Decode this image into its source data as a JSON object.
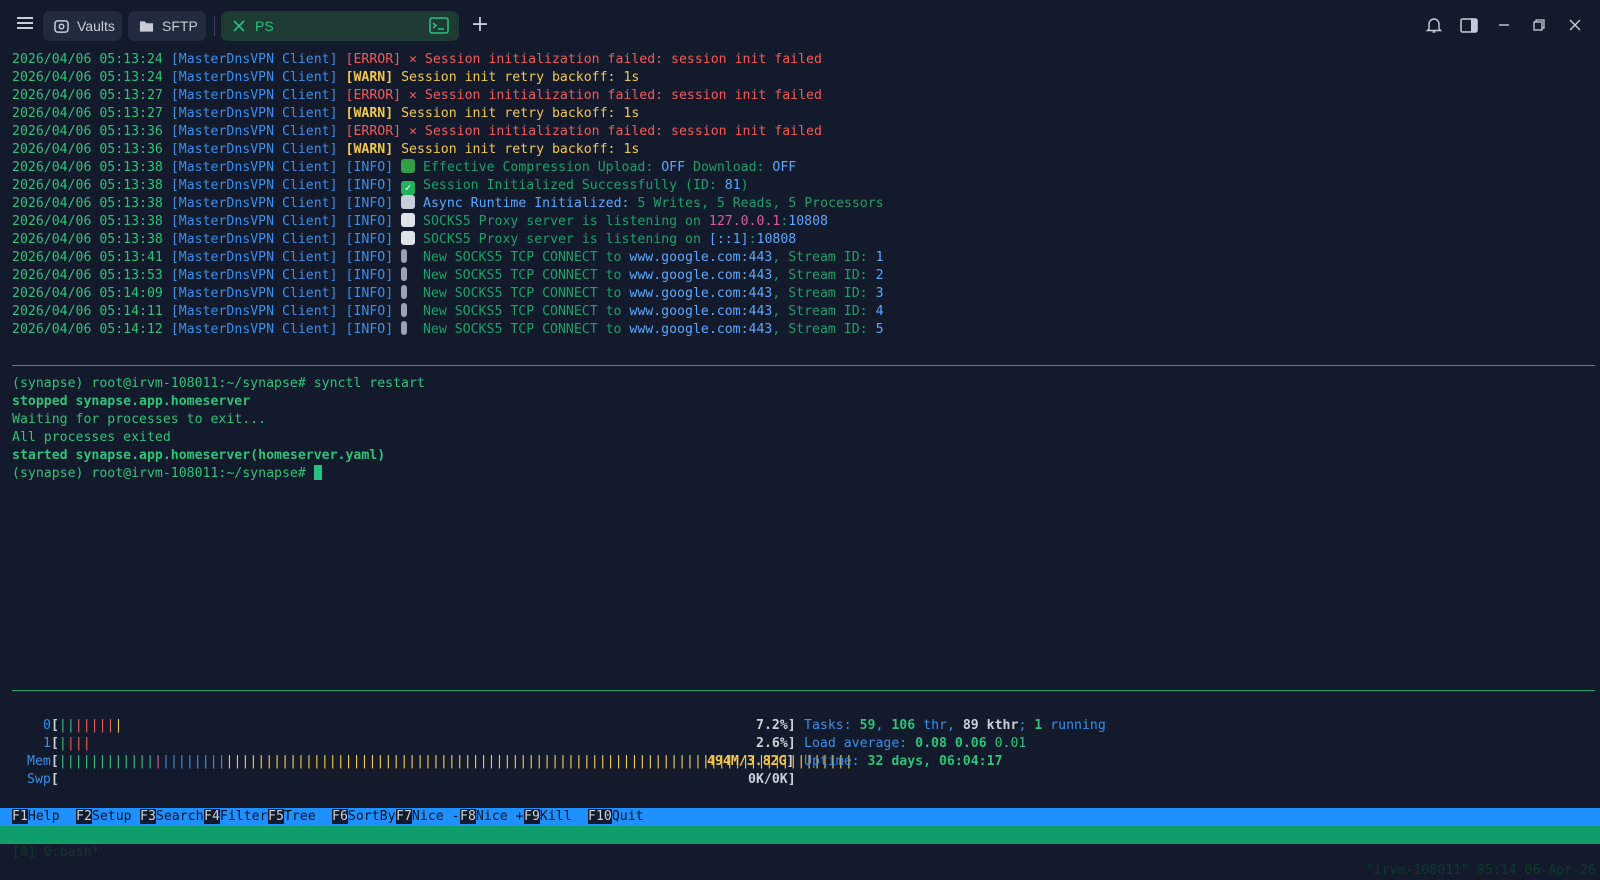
{
  "titlebar": {
    "tabs": [
      {
        "label": "Vaults",
        "icon": "vault-icon"
      },
      {
        "label": "SFTP",
        "icon": "folder-icon"
      },
      {
        "label": "PS",
        "icon": "close-icon",
        "active": true
      }
    ],
    "new_tab": "+"
  },
  "log": {
    "source": "[MasterDnsVPN Client]",
    "lines": [
      {
        "ts": "2026/04/06 05:13:24",
        "level": "[ERROR]",
        "msg": " Session initialization failed: session init failed"
      },
      {
        "ts": "2026/04/06 05:13:24",
        "level": "[WARN]",
        "msg": "Session init retry backoff: 1s"
      },
      {
        "ts": "2026/04/06 05:13:27",
        "level": "[ERROR]",
        "msg": " Session initialization failed: session init failed"
      },
      {
        "ts": "2026/04/06 05:13:27",
        "level": "[WARN]",
        "msg": "Session init retry backoff: 1s"
      },
      {
        "ts": "2026/04/06 05:13:36",
        "level": "[ERROR]",
        "msg": " Session initialization failed: session init failed"
      },
      {
        "ts": "2026/04/06 05:13:36",
        "level": "[WARN]",
        "msg": "Session init retry backoff: 1s"
      },
      {
        "ts": "2026/04/06 05:13:38",
        "level": "[INFO]",
        "p1": "Effective Compression Upload: ",
        "v1": "OFF",
        "p2": " Download: ",
        "v2": "OFF"
      },
      {
        "ts": "2026/04/06 05:13:38",
        "level": "[INFO]",
        "p1": "Session Initialized Successfully (ID: ",
        "v1": "81",
        "p2": ")"
      },
      {
        "ts": "2026/04/06 05:13:38",
        "level": "[INFO]",
        "p1": "Async Runtime Initialized: ",
        "v1": "5",
        "p2": " Writes, ",
        "v2": "5",
        "p3": " Reads, ",
        "v3": "5",
        "p4": " Processors"
      },
      {
        "ts": "2026/04/06 05:13:38",
        "level": "[INFO]",
        "p1": "SOCKS5 Proxy server is listening on ",
        "v1": "127.0.0.1",
        "p2": ":",
        "v2": "10808"
      },
      {
        "ts": "2026/04/06 05:13:38",
        "level": "[INFO]",
        "p1": "SOCKS5 Proxy server is listening on ",
        "v1": "[::1]",
        "p2": ":",
        "v2": "10808"
      },
      {
        "ts": "2026/04/06 05:13:41",
        "level": "[INFO]",
        "p1": "New SOCKS5 TCP CONNECT to ",
        "v1": "www.google.com:443",
        "p2": ", Stream ID: ",
        "v2": "1"
      },
      {
        "ts": "2026/04/06 05:13:53",
        "level": "[INFO]",
        "p1": "New SOCKS5 TCP CONNECT to ",
        "v1": "www.google.com:443",
        "p2": ", Stream ID: ",
        "v2": "2"
      },
      {
        "ts": "2026/04/06 05:14:09",
        "level": "[INFO]",
        "p1": "New SOCKS5 TCP CONNECT to ",
        "v1": "www.google.com:443",
        "p2": ", Stream ID: ",
        "v2": "3"
      },
      {
        "ts": "2026/04/06 05:14:11",
        "level": "[INFO]",
        "p1": "New SOCKS5 TCP CONNECT to ",
        "v1": "www.google.com:443",
        "p2": ", Stream ID: ",
        "v2": "4"
      },
      {
        "ts": "2026/04/06 05:14:12",
        "level": "[INFO]",
        "p1": "New SOCKS5 TCP CONNECT to ",
        "v1": "www.google.com:443",
        "p2": ", Stream ID: ",
        "v2": "5"
      }
    ]
  },
  "shell": {
    "prompt": "(synapse) root@irvm-108011:~/synapse# ",
    "command": "synctl restart",
    "out1": "stopped synapse.app.homeserver",
    "out2": "Waiting for processes to exit...",
    "out3": "All processes exited",
    "out4": "started synapse.app.homeserver(homeserver.yaml)"
  },
  "htop": {
    "cpu0": {
      "label": "0",
      "pct": "7.2%"
    },
    "cpu1": {
      "label": "1",
      "pct": "2.6%"
    },
    "mem": {
      "label": "Mem",
      "value": "494M/3.82G"
    },
    "swp": {
      "label": "Swp",
      "value": "0K/0K"
    },
    "tasks": {
      "label": "Tasks: ",
      "tasks": "59",
      "sep1": ", ",
      "thr": "106",
      "thr_label": " thr",
      "sep2": ", ",
      "kthr": "89",
      "kthr_label": " kthr",
      "sep3": "; ",
      "running": "1",
      "running_label": " running"
    },
    "load": {
      "label": "Load average: ",
      "l1": "0.08",
      "l5": "0.06",
      "l15": "0.01"
    },
    "uptime": {
      "label": "Uptime: ",
      "value": "32 days, 06:04:17"
    },
    "fkeys": [
      {
        "key": "F1",
        "label": "Help  "
      },
      {
        "key": "F2",
        "label": "Setup "
      },
      {
        "key": "F3",
        "label": "Search"
      },
      {
        "key": "F4",
        "label": "Filter"
      },
      {
        "key": "F5",
        "label": "Tree  "
      },
      {
        "key": "F6",
        "label": "SortBy"
      },
      {
        "key": "F7",
        "label": "Nice -"
      },
      {
        "key": "F8",
        "label": "Nice +"
      },
      {
        "key": "F9",
        "label": "Kill  "
      },
      {
        "key": "F10",
        "label": "Quit"
      }
    ]
  },
  "tmux": {
    "left": "[0] 0:bash*",
    "right": "\"irvm-108011\" 05:14 06-Apr-26"
  },
  "colors": {
    "accent": "#26c281",
    "fkey_bar": "#1e90ff",
    "tmux_bar": "#0f9d6a",
    "error": "#f25a5a",
    "warn": "#f2c94c"
  }
}
